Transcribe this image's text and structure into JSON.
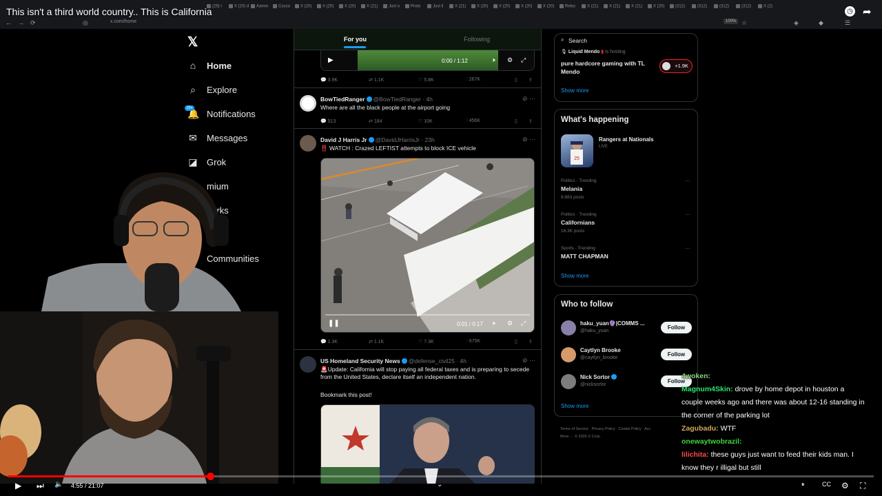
{
  "video": {
    "title": "This isn't a third world country.. This is California",
    "time": "4:55 / 21:07",
    "progress_fraction": 0.233
  },
  "browser": {
    "url": "x.com/home",
    "zoom": "100%",
    "tabs": [
      "(29) i",
      "X (20) d",
      "Aamm",
      "Cocco",
      "X (20)",
      "X (20)",
      "X (20)",
      "X (21)",
      "Just o",
      "Proto",
      "Just li",
      "X (21)",
      "X (20)",
      "X (20)",
      "X (20)",
      "X (20)",
      "Reloc",
      "X (21)",
      "X (21)",
      "X (21)",
      "X (20)",
      "(312)",
      "(312)",
      "(312)",
      "(312)",
      "X (2)"
    ]
  },
  "nav": {
    "items": [
      {
        "label": "Home",
        "icon": "home-icon",
        "active": true
      },
      {
        "label": "Explore",
        "icon": "search-icon"
      },
      {
        "label": "Notifications",
        "icon": "bell-icon"
      },
      {
        "label": "Messages",
        "icon": "mail-icon"
      },
      {
        "label": "Grok",
        "icon": "grok-icon"
      },
      {
        "label": "mium",
        "icon": "premium-icon"
      },
      {
        "label": "narks",
        "icon": "bookmark-icon"
      },
      {
        "label": "ps",
        "icon": "jobs-icon"
      },
      {
        "label": "Communities",
        "icon": "communities-icon"
      }
    ],
    "notif_badge": "20+"
  },
  "feed": {
    "tabs": [
      "For you",
      "Following"
    ],
    "top_video": {
      "time": "0:00 / 1:12",
      "stats": [
        "3.9K",
        "1.1K",
        "5.8K",
        "267K"
      ]
    },
    "tweets": [
      {
        "name": "BowTiedRanger",
        "handle": "@BowTiedRanger · 4h",
        "text": "Where are all the black people at the airport going",
        "stats": [
          "513",
          "184",
          "10K",
          "456K"
        ]
      },
      {
        "name": "David J Harris Jr",
        "handle": "@DavidJHarrisJr · 23h",
        "text": "‼️ WATCH : Crazed LEFTIST attempts to block ICE vehicle",
        "video_time": "0:01 / 0:17",
        "stats": [
          "1.3K",
          "1.1K",
          "7.3K",
          "675K"
        ]
      },
      {
        "name": "US Homeland Security News",
        "handle": "@defense_civil25 · 4h",
        "text": "🚨Update: California will stop paying all federal taxes and is preparing to secede from the United States, declare itself an independent nation.",
        "text2": "Bookmark this post!"
      }
    ]
  },
  "right": {
    "search_placeholder": "Search",
    "live": {
      "host": "Liquid Mendo",
      "host_suffix": "is hosting",
      "title": "pure hardcore gaming with TL Mendo",
      "count": "+1.9K",
      "show_more": "Show more"
    },
    "happening": {
      "title": "What's happening",
      "event": "Rangers at Nationals",
      "event_status": "LIVE",
      "trends": [
        {
          "meta": "Politics · Trending",
          "name": "Melania",
          "posts": "8,883 posts"
        },
        {
          "meta": "Politics · Trending",
          "name": "Californians",
          "posts": "16.3K posts"
        },
        {
          "meta": "Sports · Trending",
          "name": "MATT CHAPMAN",
          "posts": ""
        }
      ],
      "show_more": "Show more"
    },
    "follow": {
      "title": "Who to follow",
      "people": [
        {
          "name": "haku_yuan🔮|COMMS ...",
          "handle": "@haku_yuan",
          "btn": "Follow"
        },
        {
          "name": "Caytlyn Brooke",
          "handle": "@caytlyn_brooke",
          "btn": "Follow"
        },
        {
          "name": "Nick Sortor",
          "handle": "@nicksortor",
          "btn": "Follow"
        }
      ],
      "show_more": "Show more"
    },
    "footer": [
      "Terms of Service",
      "Privacy Policy",
      "Cookie Policy",
      "Acc",
      "More ···",
      "© 2025 X Corp."
    ]
  },
  "chat": [
    {
      "user": "4woken:",
      "msg": "",
      "color": "#8bd17a"
    },
    {
      "user": "Magnum4Skin:",
      "msg": "drove by home depot in houston a",
      "color": "#2fe36e"
    },
    {
      "user": "",
      "msg": "couple weeks ago and there was about 12-16 standing in",
      "color": ""
    },
    {
      "user": "",
      "msg": "the corner of the parking lot",
      "color": ""
    },
    {
      "user": "Zagubadu:",
      "msg": "WTF",
      "color": "#d2a65a"
    },
    {
      "user": "onewaytwobrazil:",
      "msg": "",
      "color": "#3fd63f"
    },
    {
      "user": "lilichita:",
      "msg": "these guys just want to feed their kids man. I",
      "color": "#ff4a4a"
    },
    {
      "user": "",
      "msg": "know they r illigal but still",
      "color": ""
    }
  ],
  "colors": {
    "accent": "#1d9bf0",
    "progress": "#ff0000",
    "bg": "#000000"
  }
}
